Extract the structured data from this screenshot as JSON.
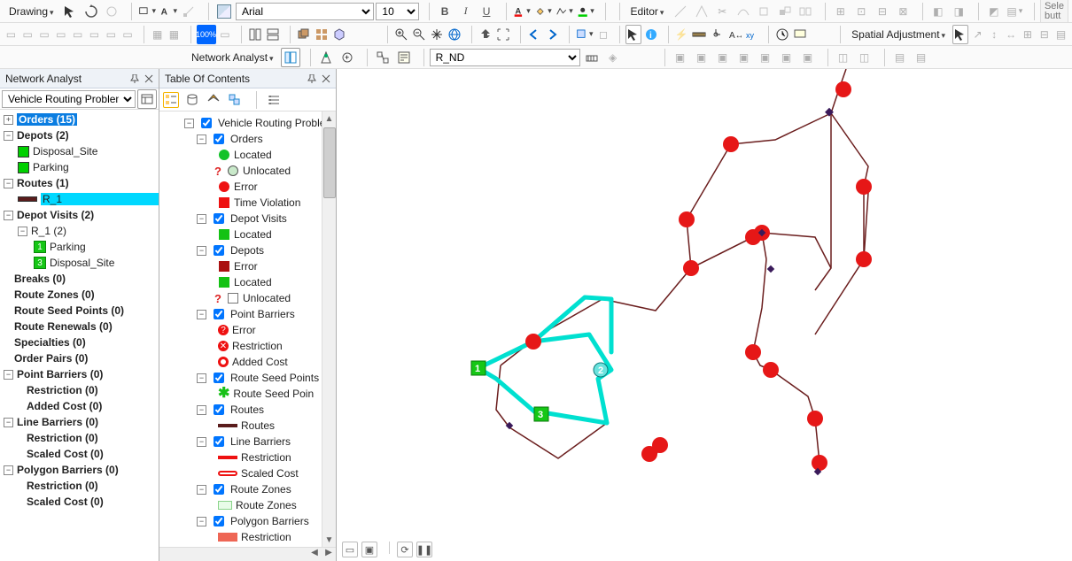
{
  "toolbars": {
    "drawing_label": "Drawing",
    "font_family": "Arial",
    "font_size": "10",
    "bold": "B",
    "italic": "I",
    "underline": "U",
    "editor_label": "Editor",
    "more_buttons": "Sele\nbutt",
    "na_label": "Network Analyst",
    "nd_select": "R_ND",
    "spatial_adj": "Spatial Adjustment"
  },
  "na_panel": {
    "title": "Network Analyst",
    "layer_select": "Vehicle Routing Problem",
    "items": {
      "orders": "Orders (15)",
      "depots": "Depots (2)",
      "disposal": "Disposal_Site",
      "parking": "Parking",
      "routes": "Routes (1)",
      "r1": "R_1",
      "depot_visits": "Depot Visits (2)",
      "r1_2": "R_1 (2)",
      "dv_parking": "Parking",
      "dv_disposal": "Disposal_Site",
      "breaks": "Breaks (0)",
      "route_zones": "Route Zones (0)",
      "rsp": "Route Seed Points (0)",
      "renewals": "Route Renewals (0)",
      "specialties": "Specialties (0)",
      "order_pairs": "Order Pairs (0)",
      "point_barriers": "Point Barriers (0)",
      "pb_restriction": "Restriction (0)",
      "pb_added": "Added Cost (0)",
      "line_barriers": "Line Barriers (0)",
      "lb_restriction": "Restriction (0)",
      "lb_scaled": "Scaled Cost (0)",
      "poly_barriers": "Polygon Barriers (0)",
      "pob_restriction": "Restriction (0)",
      "pob_scaled": "Scaled Cost (0)"
    }
  },
  "toc": {
    "title": "Table Of Contents",
    "root": "Vehicle Routing Proble",
    "orders": "Orders",
    "orders_located": "Located",
    "orders_unlocated": "Unlocated",
    "orders_error": "Error",
    "orders_tv": "Time Violation",
    "depot_visits": "Depot Visits",
    "dv_located": "Located",
    "depots": "Depots",
    "depots_error": "Error",
    "depots_located": "Located",
    "depots_unlocated": "Unlocated",
    "point_barriers": "Point Barriers",
    "pb_error": "Error",
    "pb_restriction": "Restriction",
    "pb_added": "Added Cost",
    "rsp": "Route Seed Points",
    "rsp_sub": "Route Seed Poin",
    "routes": "Routes",
    "routes_sub": "Routes",
    "line_barriers": "Line Barriers",
    "lb_restriction": "Restriction",
    "lb_scaled": "Scaled Cost",
    "route_zones": "Route Zones",
    "rz_sub": "Route Zones",
    "poly_barriers": "Polygon Barriers",
    "polb_restriction": "Restriction"
  },
  "map": {
    "markers": {
      "m1": "1",
      "m2": "2",
      "m3": "3"
    }
  }
}
